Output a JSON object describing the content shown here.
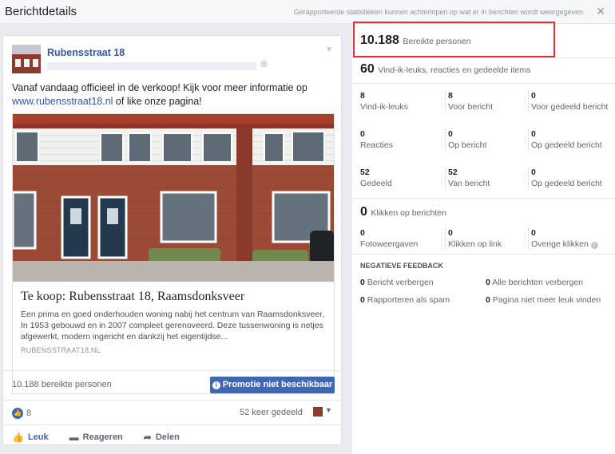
{
  "header": {
    "title": "Berichtdetails",
    "note": "Gerapporteerde statistieken kunnen achterlopen op wat er in berichten wordt weergegeven",
    "close": "✕"
  },
  "post": {
    "page_name": "Rubensstraat 18",
    "text_before_link": "Vanaf vandaag officieel in de verkoop! Kijk voor meer informatie op ",
    "link_text": "www.rubensstraat18.nl",
    "text_after_link": " of like onze pagina!",
    "link_preview": {
      "title": "Te koop: Rubensstraat 18, Raamsdonksveer",
      "description": "Een prima en goed onderhouden woning nabij het centrum van Raamsdonksveer. In 1953 gebouwd en in 2007 compleet gerenoveerd. Deze tussenwoning is netjes afgewerkt, modern ingericht en dankzij het eigentijdse...",
      "domain": "RUBENSSTRAAT18.NL"
    },
    "reach_label": "10.188 bereikte personen",
    "promo_button": "Promotie niet beschikbaar",
    "like_count": "8",
    "shares": "52 keer gedeeld",
    "actions": {
      "like": "Leuk",
      "comment": "Reageren",
      "share": "Delen"
    },
    "icons": {
      "like": "thumbs-up-icon",
      "comment": "comment-icon",
      "share": "share-arrow-icon"
    }
  },
  "stats": {
    "reach_num": "10.188",
    "reach_label": "Bereikte personen",
    "engagement_num": "60",
    "engagement_label": "Vind-ik-leuks, reacties en gedeelde items",
    "grid": [
      [
        {
          "n": "8",
          "l": "Vind-ik-leuks"
        },
        {
          "n": "8",
          "l": "Voor bericht"
        },
        {
          "n": "0",
          "l": "Voor gedeeld bericht"
        }
      ],
      [
        {
          "n": "0",
          "l": "Reacties"
        },
        {
          "n": "0",
          "l": "Op bericht"
        },
        {
          "n": "0",
          "l": "Op gedeeld bericht"
        }
      ],
      [
        {
          "n": "52",
          "l": "Gedeeld"
        },
        {
          "n": "52",
          "l": "Van bericht"
        },
        {
          "n": "0",
          "l": "Op gedeeld bericht"
        }
      ]
    ],
    "clicks_num": "0",
    "clicks_label": "Klikken op berichten",
    "clicks_grid": [
      {
        "n": "0",
        "l": "Fotoweergaven"
      },
      {
        "n": "0",
        "l": "Klikken op link"
      },
      {
        "n": "0",
        "l": "Overige klikken"
      }
    ],
    "negative_title": "NEGATIEVE FEEDBACK",
    "negative": [
      {
        "n": "0",
        "l": "Bericht verbergen"
      },
      {
        "n": "0",
        "l": "Alle berichten verbergen"
      },
      {
        "n": "0",
        "l": "Rapporteren als spam"
      },
      {
        "n": "0",
        "l": "Pagina niet meer leuk vinden"
      }
    ]
  },
  "colors": {
    "accent": "#4267b2",
    "link": "#365899",
    "highlight": "#e0312f"
  }
}
